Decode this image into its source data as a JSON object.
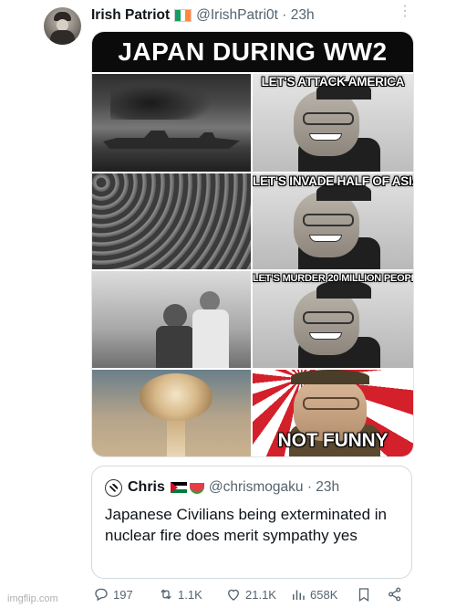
{
  "tweet": {
    "display_name": "Irish Patriot",
    "handle_time": "@IrishPatri0t · 23h",
    "flag_colors": [
      "#169b62",
      "#ffffff",
      "#ff883e"
    ]
  },
  "meme": {
    "title": "JAPAN DURING WW2",
    "captions": [
      "LET'S ATTACK AMERICA",
      "LET'S INVADE HALF OF ASIA",
      "LET'S MURDER 20 MILLION PEOPLE",
      "NOT FUNNY"
    ]
  },
  "quote": {
    "display_name": "Chris",
    "handle_time": "@chrismogaku · 23h",
    "text": "Japanese Civilians being exterminated in nuclear fire does merit sympathy yes"
  },
  "actions": {
    "replies": "197",
    "reposts": "1.1K",
    "likes": "21.1K",
    "views": "658K"
  },
  "watermark": "imgflip.com",
  "colors": {
    "text": "#0f1419",
    "secondary": "#536471",
    "border": "#cfd9de"
  }
}
